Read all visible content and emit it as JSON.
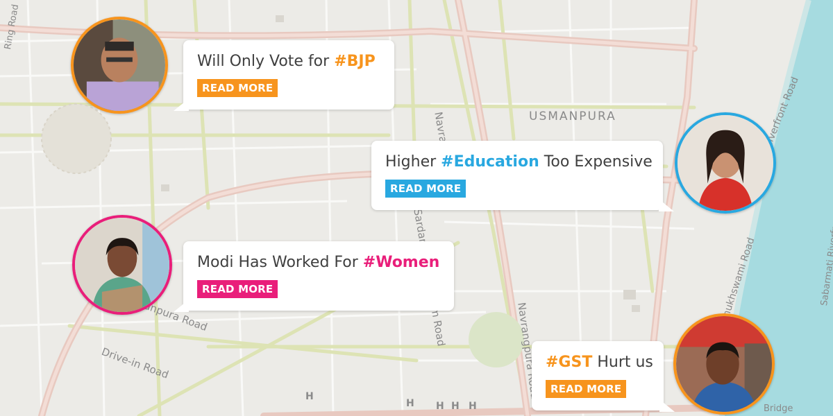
{
  "map": {
    "area_label": "USMANPURA",
    "roads": {
      "navrangpura_road_1": "Navrangpura Road",
      "navrangpura_road_2": "Navrangpura Road",
      "usmanpura_road": "Usmanpura Road",
      "drive_in_road": "Drive-in Road",
      "stadium_road": "Sardar Patel Stadium Road",
      "pramukhswami_road": "Pramukhswami Road",
      "riverfront_road": "Riverfront Road",
      "sabarmati_riverfront": "Sabarmati Riverfront",
      "bridge": "Bridge",
      "ring_road": "Ring Road"
    },
    "markers": [
      "H",
      "H",
      "H",
      "H",
      "H"
    ]
  },
  "stories": [
    {
      "prefix": "Will Only Vote for ",
      "hashtag": "#BJP",
      "suffix": "",
      "button": "READ MORE",
      "color": "#f7941d"
    },
    {
      "prefix": "Higher ",
      "hashtag": "#Education",
      "suffix": " Too Expensive",
      "button": "READ MORE",
      "color": "#29a8e0"
    },
    {
      "prefix": "Modi Has Worked For ",
      "hashtag": "#Women",
      "suffix": "",
      "button": "READ MORE",
      "color": "#e91e7a"
    },
    {
      "prefix": "",
      "hashtag": "#GST",
      "suffix": " Hurt us",
      "button": "READ MORE",
      "color": "#f7941d"
    }
  ]
}
